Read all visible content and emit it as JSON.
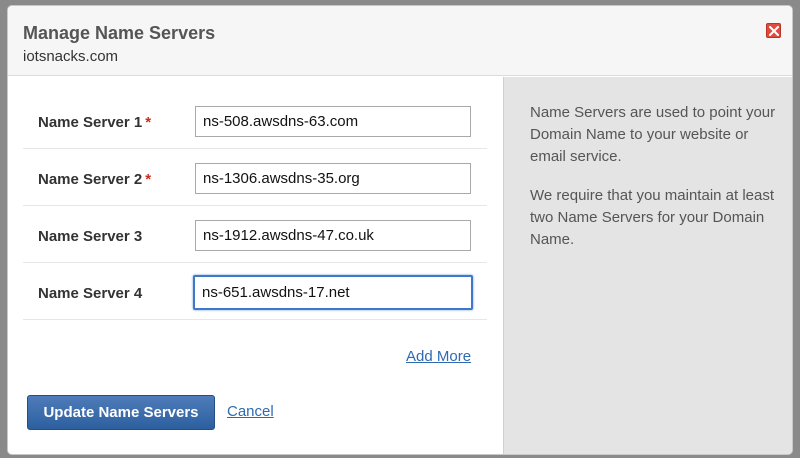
{
  "dialog": {
    "title": "Manage Name Servers",
    "domain": "iotsnacks.com",
    "close_icon": "close-icon",
    "accent_color": "#2c5f9f",
    "close_color": "#e14b3b"
  },
  "fields": [
    {
      "label": "Name Server 1",
      "required": "*",
      "value": "ns-508.awsdns-63.com"
    },
    {
      "label": "Name Server 2",
      "required": "*",
      "value": "ns-1306.awsdns-35.org"
    },
    {
      "label": "Name Server 3",
      "value": "ns-1912.awsdns-47.co.uk"
    },
    {
      "label": "Name Server 4",
      "value": "ns-651.awsdns-17.net"
    }
  ],
  "actions": {
    "add_more": "Add More",
    "update": "Update Name Servers",
    "cancel": "Cancel"
  },
  "help": {
    "para1": "Name Servers are used to point your Domain Name to your website or email service.",
    "para2": "We require that you maintain at least two Name Servers for your Domain Name."
  }
}
